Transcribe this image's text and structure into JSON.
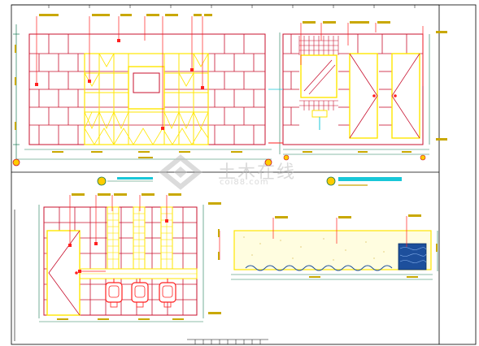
{
  "drawing": {
    "colors": {
      "background": "#ffffff",
      "frame": "#000000",
      "tile_grid": "#c8102e",
      "tile_grid_dark": "#a00010",
      "highlight": "#ffe600",
      "leader_red": "#ff2020",
      "dimension_green": "#1a7a55",
      "dimension_text": "#c9a800",
      "accent_cyan": "#19c7d8",
      "marble_blue": "#1d4f9c"
    },
    "panels": [
      {
        "name": "elevation-a",
        "type": "wall-with-window-and-panels"
      },
      {
        "name": "elevation-b",
        "type": "wall-with-mirror-and-doors"
      },
      {
        "name": "elevation-c",
        "type": "wall-with-door-and-urinals"
      },
      {
        "name": "section-d",
        "type": "counter-section"
      }
    ],
    "icons": [
      "section-marker-icon",
      "section-marker-icon"
    ]
  },
  "watermark": {
    "chinese": "土木在线",
    "domain": "coi88.com"
  }
}
